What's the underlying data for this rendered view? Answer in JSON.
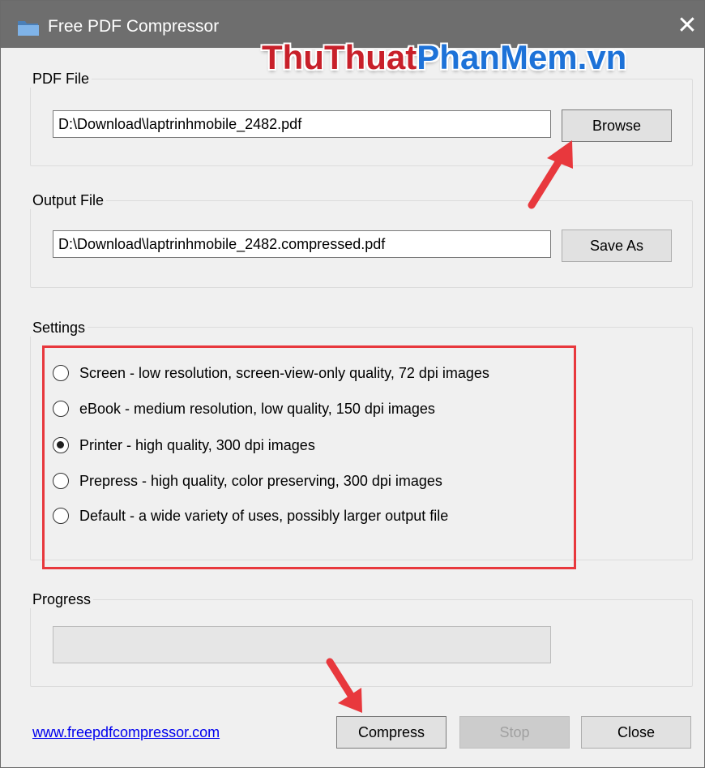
{
  "window": {
    "title": "Free PDF Compressor",
    "close_glyph": "✕",
    "icon": "folder-icon"
  },
  "watermark": {
    "part1": "ThuThuat",
    "part2": "PhanMem",
    "part3": ".vn",
    "colors": {
      "red": "#c8202a",
      "blue": "#1d72d8"
    }
  },
  "pdf_file": {
    "group_label": "PDF File",
    "path": "D:\\Download\\laptrinhmobile_2482.pdf",
    "browse_label": "Browse"
  },
  "output_file": {
    "group_label": "Output File",
    "path": "D:\\Download\\laptrinhmobile_2482.compressed.pdf",
    "save_as_label": "Save As"
  },
  "settings": {
    "group_label": "Settings",
    "options": [
      {
        "label": "Screen - low resolution, screen-view-only quality, 72 dpi images",
        "checked": false
      },
      {
        "label": "eBook - medium resolution, low quality, 150 dpi images",
        "checked": false
      },
      {
        "label": "Printer - high quality, 300 dpi images",
        "checked": true
      },
      {
        "label": "Prepress - high quality, color preserving, 300 dpi images",
        "checked": false
      },
      {
        "label": "Default - a wide variety of uses, possibly larger output file",
        "checked": false
      }
    ],
    "highlight_color": "#e8383d"
  },
  "progress": {
    "group_label": "Progress",
    "value": 0
  },
  "footer": {
    "link_text": "www.freepdfcompressor.com",
    "compress_label": "Compress",
    "stop_label": "Stop",
    "close_label": "Close"
  },
  "annotations": {
    "arrow_color": "#e8383d"
  }
}
